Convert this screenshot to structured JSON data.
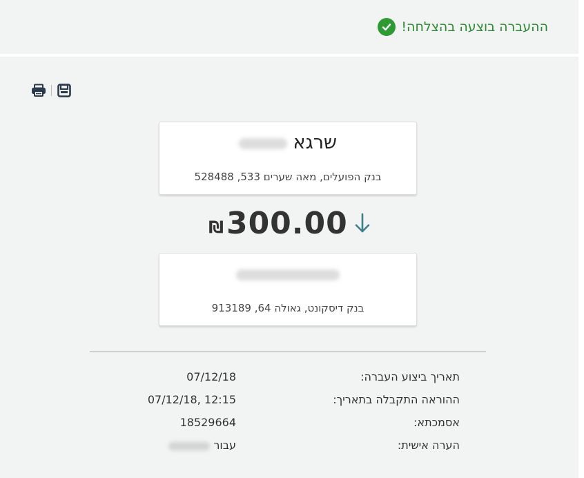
{
  "success": {
    "message": "ההעברה בוצעה בהצלחה!",
    "icon": "check-circle-icon",
    "color": "#2f9a34"
  },
  "toolbar": {
    "print_icon": "print-icon",
    "save_icon": "save-icon"
  },
  "from_account": {
    "name": "שרגא",
    "bank": "בנק הפועלים, מאה שערים 533, 528488"
  },
  "transfer": {
    "currency": "₪",
    "amount": "300.00",
    "direction_icon": "arrow-down-icon",
    "arrow_color": "#3d7f8b"
  },
  "to_account": {
    "name": "",
    "bank": "בנק דיסקונט, גאולה 64, 913189"
  },
  "details": [
    {
      "label": "תאריך ביצוע העברה:",
      "value": "07/12/18"
    },
    {
      "label": "ההוראה התקבלה בתאריך:",
      "value": "12:15 ,07/12/18"
    },
    {
      "label": "אסמכתא:",
      "value": "18529664"
    },
    {
      "label": "הערה אישית:",
      "value": "עבור"
    }
  ]
}
